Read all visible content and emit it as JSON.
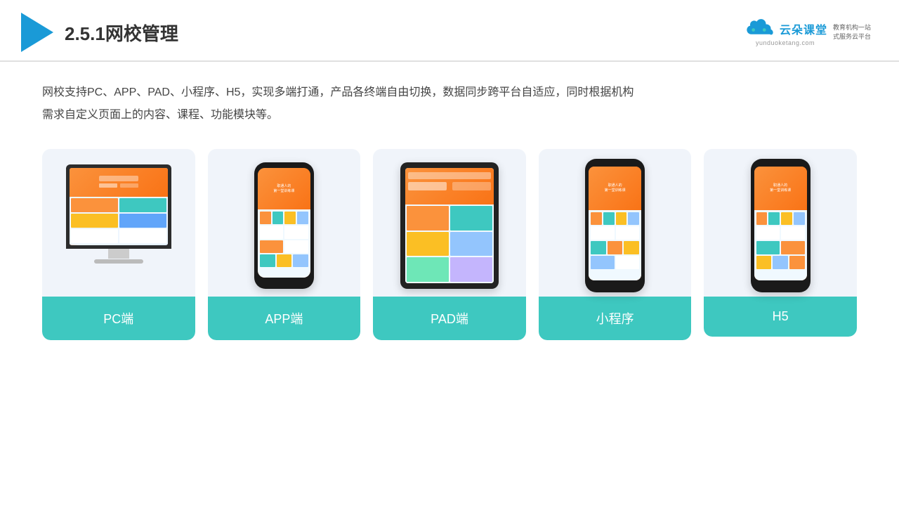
{
  "header": {
    "title": "2.5.1网校管理",
    "brand": {
      "name": "云朵课堂",
      "url": "yunduoketang.com",
      "tagline": "教育机构一站\n式服务云平台"
    }
  },
  "description": "网校支持PC、APP、PAD、小程序、H5，实现多端打通，产品各终端自由切换，数据同步跨平台自适应，同时根据机构\n需求自定义页面上的内容、课程、功能模块等。",
  "cards": [
    {
      "id": "pc",
      "label": "PC端"
    },
    {
      "id": "app",
      "label": "APP端"
    },
    {
      "id": "pad",
      "label": "PAD端"
    },
    {
      "id": "miniprogram",
      "label": "小程序"
    },
    {
      "id": "h5",
      "label": "H5"
    }
  ],
  "accent_color": "#3ec8c0"
}
